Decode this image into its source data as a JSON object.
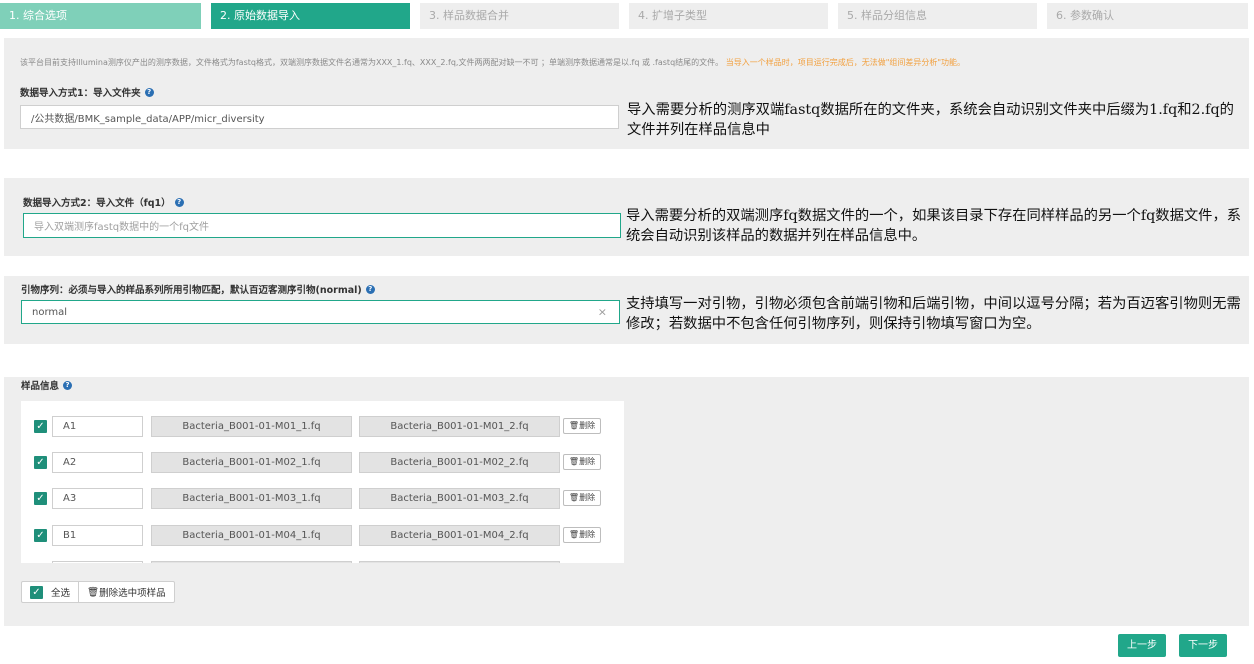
{
  "steps": [
    {
      "label": "1. 综合选项"
    },
    {
      "label": "2. 原始数据导入"
    },
    {
      "label": "3. 样品数据合并"
    },
    {
      "label": "4. 扩增子类型"
    },
    {
      "label": "5. 样品分组信息"
    },
    {
      "label": "6. 参数确认"
    }
  ],
  "notice": {
    "text": "该平台目前支持Illumina测序仪产出的测序数据，文件格式为fastq格式，双端测序数据文件名通常为XXX_1.fq、XXX_2.fq,文件两两配对缺一不可 ；单端测序数据通常是以.fq 或 .fastq结尾的文件。",
    "warning": "当导入一个样品时，项目运行完成后，无法做\"组间差异分析\"功能。"
  },
  "folder_import": {
    "label": "数据导入方式1：导入文件夹",
    "value": "/公共数据/BMK_sample_data/APP/micr_diversity",
    "annotation": "导入需要分析的测序双端fastq数据所在的文件夹，系统会自动识别文件夹中后缀为1.fq和2.fq的文件并列在样品信息中"
  },
  "file_import": {
    "label": "数据导入方式2：导入文件（fq1）",
    "placeholder": "导入双端测序fastq数据中的一个fq文件",
    "annotation": "导入需要分析的双端测序fq数据文件的一个，如果该目录下存在同样样品的另一个fq数据文件，系统会自动识别该样品的数据并列在样品信息中。"
  },
  "primer": {
    "label": "引物序列：必须与导入的样品系列所用引物匹配，默认百迈客测序引物(normal)",
    "value": "normal",
    "clear": "×",
    "annotation": "支持填写一对引物，引物必须包含前端引物和后端引物，中间以逗号分隔；若为百迈客引物则无需修改；若数据中不包含任何引物序列，则保持引物填写窗口为空。"
  },
  "samples": {
    "label": "样品信息",
    "delete_label": "删除",
    "rows": [
      {
        "name": "A1",
        "fq1": "Bacteria_B001-01-M01_1.fq",
        "fq2": "Bacteria_B001-01-M01_2.fq"
      },
      {
        "name": "A2",
        "fq1": "Bacteria_B001-01-M02_1.fq",
        "fq2": "Bacteria_B001-01-M02_2.fq"
      },
      {
        "name": "A3",
        "fq1": "Bacteria_B001-01-M03_1.fq",
        "fq2": "Bacteria_B001-01-M03_2.fq"
      },
      {
        "name": "B1",
        "fq1": "Bacteria_B001-01-M04_1.fq",
        "fq2": "Bacteria_B001-01-M04_2.fq"
      }
    ],
    "select_all": "全选",
    "delete_selected": "删除选中项样品"
  },
  "nav": {
    "prev": "上一步",
    "next": "下一步"
  },
  "colors": {
    "accent": "#21a78a",
    "step_done": "#7fd0b9",
    "warning": "#f2a03f"
  }
}
